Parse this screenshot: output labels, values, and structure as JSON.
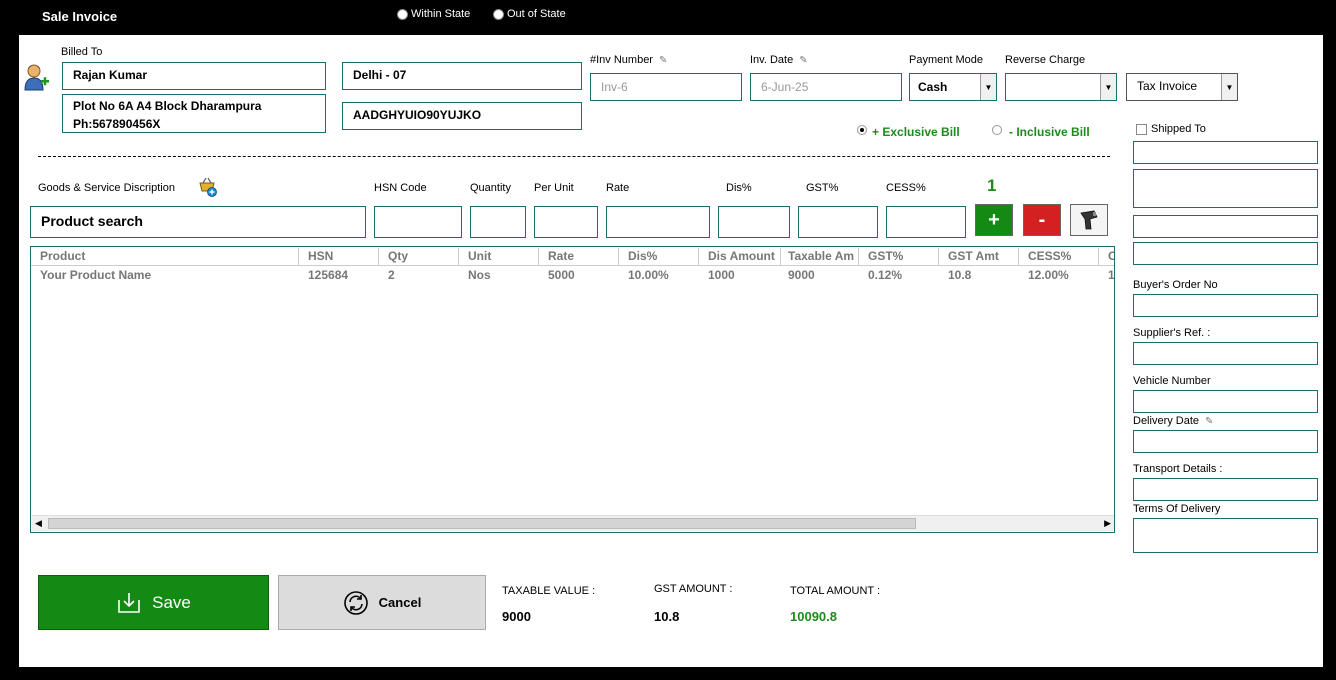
{
  "window": {
    "title": "Sale Invoice"
  },
  "state_options": [
    {
      "label": "Within State",
      "selected": false
    },
    {
      "label": "Out of State",
      "selected": false
    }
  ],
  "billed_to": {
    "label": "Billed To",
    "name": "Rajan Kumar",
    "address_line1": "Plot No 6A A4 Block Dharampura",
    "address_line2": "Ph:567890456X",
    "state": "Delhi - 07",
    "gstin": "AADGHYUIO90YUJKO"
  },
  "invoice": {
    "inv_number_label": "#Inv Number",
    "inv_number": "Inv-6",
    "inv_date_label": "Inv. Date",
    "inv_date": "6-Jun-25",
    "payment_mode_label": "Payment Mode",
    "payment_mode": "Cash",
    "reverse_charge_label": "Reverse Charge",
    "reverse_charge": "",
    "invoice_type": "Tax Invoice"
  },
  "bill_type": {
    "exclusive": "+ Exclusive Bill",
    "inclusive": "- Inclusive Bill",
    "selected": "exclusive"
  },
  "entry": {
    "goods_label": "Goods & Service Discription",
    "hsn_label": "HSN Code",
    "qty_label": "Quantity",
    "per_unit_label": "Per Unit",
    "rate_label": "Rate",
    "dis_label": "Dis%",
    "gst_label": "GST%",
    "cess_label": "CESS%",
    "product_search": "Product search",
    "item_count": "1",
    "add_symbol": "+",
    "remove_symbol": "-"
  },
  "grid": {
    "columns": [
      "Product",
      "HSN",
      "Qty",
      "Unit",
      "Rate",
      "Dis%",
      "Dis Amount",
      "Taxable Am",
      "GST%",
      "GST Amt",
      "CESS%",
      "C"
    ],
    "rows": [
      [
        "Your Product Name",
        "125684",
        "2",
        "Nos",
        "5000",
        "10.00%",
        "1000",
        "9000",
        "0.12%",
        "10.8",
        "12.00%",
        "1"
      ]
    ]
  },
  "shipping": {
    "shipped_to_label": "Shipped To",
    "buyers_order_label": "Buyer's Order No",
    "suppliers_ref_label": "Supplier's Ref. :",
    "vehicle_label": "Vehicle Number",
    "delivery_date_label": "Delivery Date",
    "transport_label": "Transport Details :",
    "terms_label": "Terms Of Delivery"
  },
  "actions": {
    "save": "Save",
    "cancel": "Cancel"
  },
  "totals": {
    "taxable_label": "TAXABLE VALUE :",
    "taxable_value": "9000",
    "gst_label": "GST AMOUNT :",
    "gst_value": "10.8",
    "total_label": "TOTAL AMOUNT :",
    "total_value": "10090.8"
  },
  "colors": {
    "accent_green": "#138a13",
    "border_teal": "#1b6e6e",
    "remove_red": "#d42020"
  }
}
